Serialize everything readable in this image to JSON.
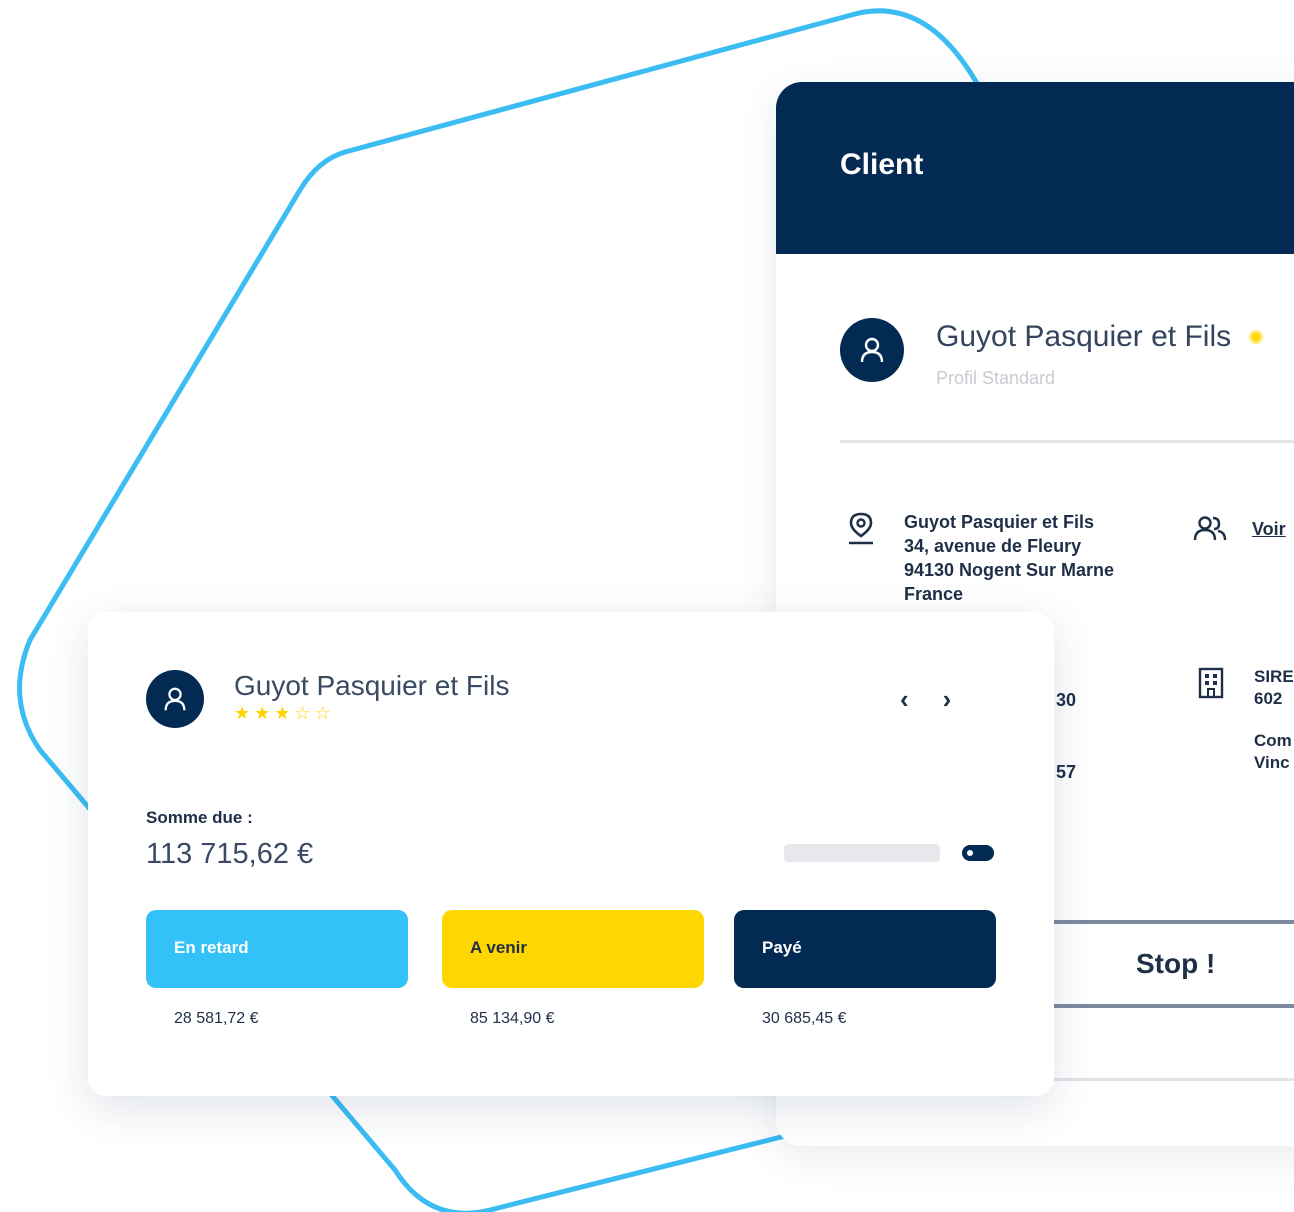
{
  "colors": {
    "navy": "#032a52",
    "sky": "#33c2f7",
    "yellow": "#ffd600",
    "hex_outline": "#3bbcf2"
  },
  "client_panel": {
    "header_title": "Client",
    "company_name": "Guyot Pasquier et Fils",
    "profile_label": "Profil Standard",
    "address_lines": [
      "Guyot Pasquier et Fils",
      "34, avenue de Fleury",
      "94130 Nogent Sur Marne",
      "France"
    ],
    "contacts_link": "Voir",
    "siret_lines": [
      "SIRE",
      "602",
      "Com",
      "Vinc"
    ],
    "phone_fragment_1": "30",
    "phone_fragment_2": "57",
    "stop_button": "Stop !"
  },
  "summary_card": {
    "company_name": "Guyot Pasquier et Fils",
    "rating": {
      "filled": 3,
      "total": 5
    },
    "sum_label": "Somme due :",
    "sum_value": "113 715,62 €",
    "prev_arrow": "‹",
    "next_arrow": "›",
    "tiles": [
      {
        "label": "En retard",
        "amount": "28 581,72 €"
      },
      {
        "label": "A venir",
        "amount": "85 134,90 €"
      },
      {
        "label": "Payé",
        "amount": "30 685,45 €"
      }
    ]
  }
}
